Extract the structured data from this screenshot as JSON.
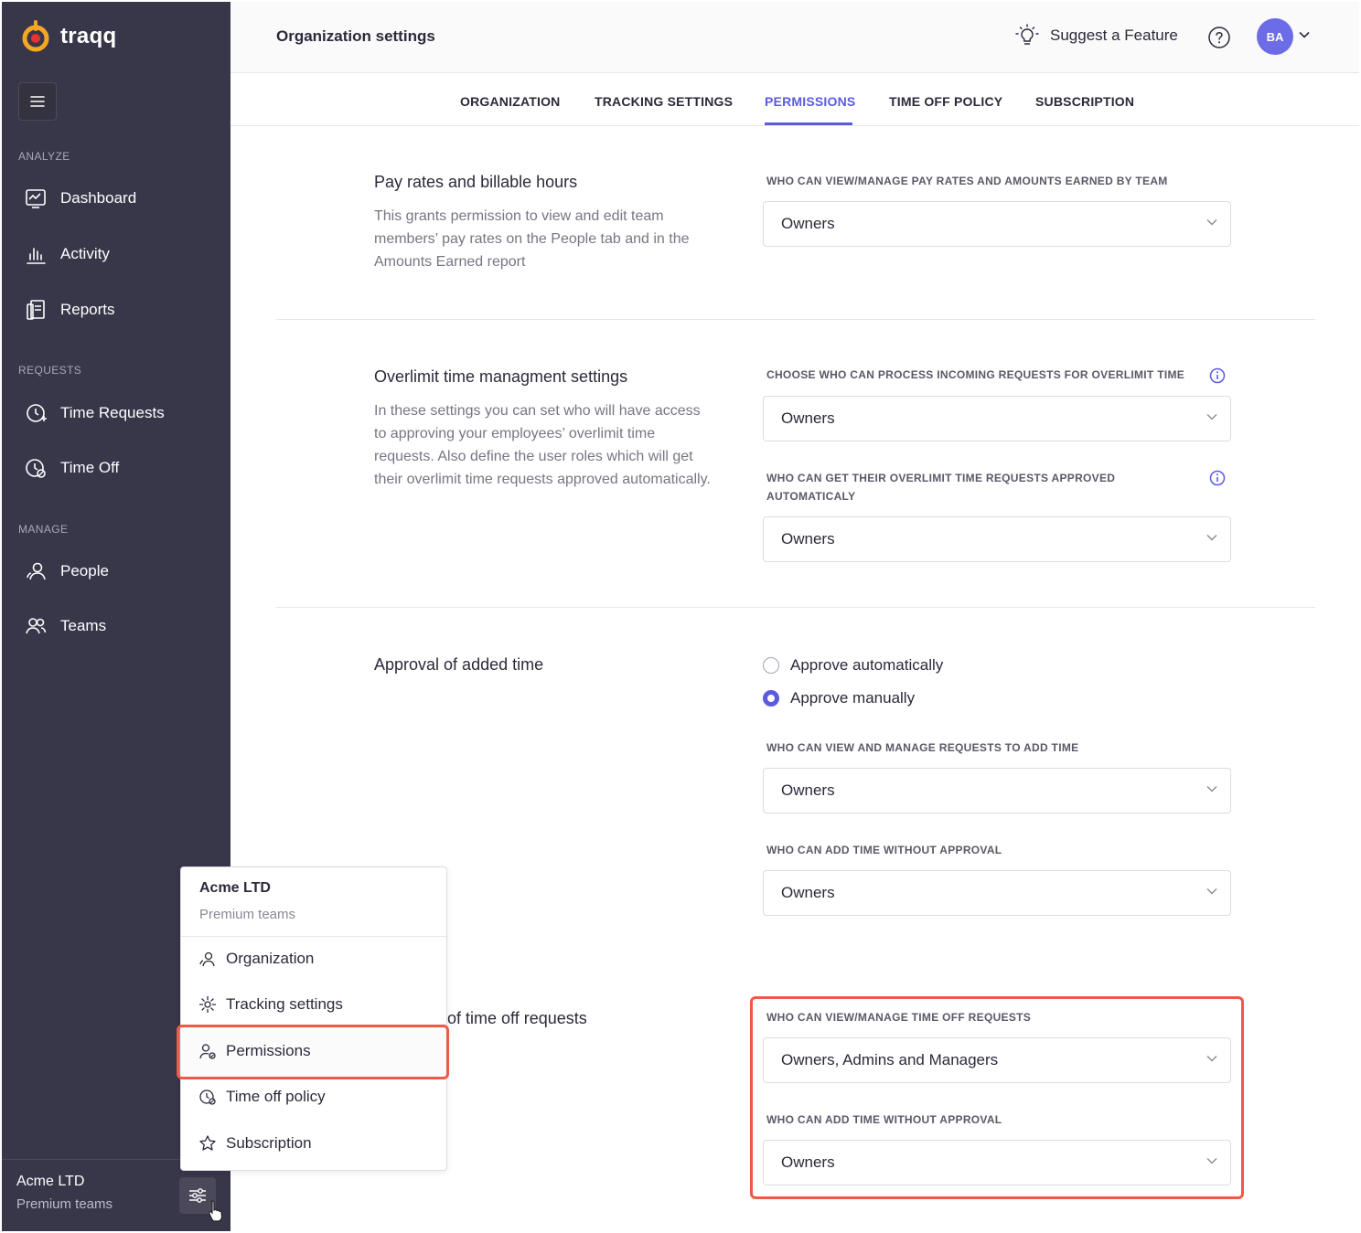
{
  "brand": {
    "name": "traqq"
  },
  "sidebar": {
    "sections": [
      {
        "label": "ANALYZE",
        "items": [
          {
            "label": "Dashboard",
            "icon": "dashboard-icon"
          },
          {
            "label": "Activity",
            "icon": "activity-icon"
          },
          {
            "label": "Reports",
            "icon": "reports-icon"
          }
        ]
      },
      {
        "label": "REQUESTS",
        "items": [
          {
            "label": "Time Requests",
            "icon": "time-requests-icon"
          },
          {
            "label": "Time Off",
            "icon": "time-off-icon"
          }
        ]
      },
      {
        "label": "MANAGE",
        "items": [
          {
            "label": "People",
            "icon": "people-icon"
          },
          {
            "label": "Teams",
            "icon": "teams-icon"
          }
        ]
      }
    ],
    "footer": {
      "org": "Acme LTD",
      "plan": "Premium teams"
    }
  },
  "header": {
    "title": "Organization settings",
    "suggest": "Suggest a Feature",
    "avatar": "BA"
  },
  "tabs": [
    {
      "label": "ORGANIZATION"
    },
    {
      "label": "TRACKING SETTINGS"
    },
    {
      "label": "PERMISSIONS",
      "active": true
    },
    {
      "label": "TIME OFF POLICY"
    },
    {
      "label": "SUBSCRIPTION"
    }
  ],
  "sections": {
    "pay": {
      "title": "Pay rates and billable hours",
      "desc": "This grants permission to view and edit team members’ pay rates on the People tab and in the Amounts Earned report",
      "label": "WHO CAN VIEW/MANAGE PAY RATES AND AMOUNTS EARNED BY TEAM",
      "value": "Owners"
    },
    "overlimit": {
      "title": "Overlimit time managment settings",
      "desc": "In these settings you can set who will have access to approving your employees’ overlimit time requests. Also define the user roles which will get their overlimit time requests approved automatically.",
      "label1": "CHOOSE WHO CAN PROCESS INCOMING REQUESTS FOR OVERLIMIT TIME",
      "value1": "Owners",
      "label2_line1": "WHO CAN GET THEIR OVERLIMIT TIME REQUESTS APPROVED",
      "label2_line2": "AUTOMATICALY",
      "value2": "Owners"
    },
    "approval": {
      "title": "Approval of added time",
      "radio_auto": "Approve automatically",
      "radio_manual": "Approve manually",
      "selected": "manual",
      "label1": "WHO CAN VIEW AND MANAGE REQUESTS TO ADD TIME",
      "value1": "Owners",
      "label2": "WHO CAN ADD TIME WITHOUT APPROVAL",
      "value2": "Owners"
    },
    "timeoff": {
      "title_partial": "of time off requests",
      "label1": "WHO CAN VIEW/MANAGE TIME OFF REQUESTS",
      "value1": "Owners, Admins and Managers",
      "label2": "WHO CAN ADD TIME WITHOUT APPROVAL",
      "value2": "Owners"
    }
  },
  "popup": {
    "org": "Acme LTD",
    "plan": "Premium teams",
    "items": [
      {
        "label": "Organization",
        "icon": "organization-icon"
      },
      {
        "label": "Tracking settings",
        "icon": "gear-icon"
      },
      {
        "label": "Permissions",
        "icon": "permissions-icon",
        "highlighted": true
      },
      {
        "label": "Time off policy",
        "icon": "time-off-policy-icon"
      },
      {
        "label": "Subscription",
        "icon": "star-icon"
      }
    ]
  },
  "colors": {
    "sidebar": "#383649",
    "accent": "#5b5be0",
    "highlight": "#ef5a47",
    "avatar": "#6b6ce6"
  }
}
